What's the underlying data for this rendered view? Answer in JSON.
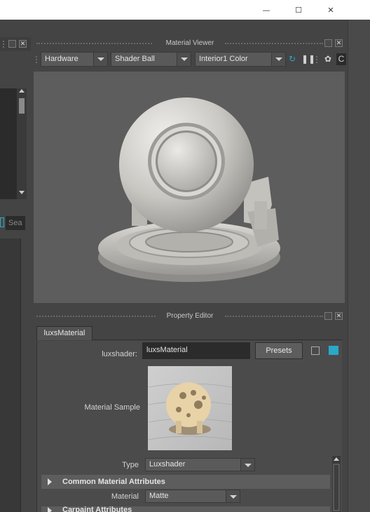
{
  "window": {
    "min_glyph": "—",
    "max_glyph": "☐",
    "close_glyph": "✕"
  },
  "left_panel": {
    "search_placeholder": "Sea"
  },
  "material_viewer": {
    "title": "Material Viewer",
    "renderer": "Hardware",
    "geometry": "Shader Ball",
    "environment": "Interior1 Color"
  },
  "property_editor": {
    "title": "Property Editor",
    "tab_label": "luxsMaterial",
    "shader_label": "luxshader:",
    "shader_value": "luxsMaterial",
    "presets_label": "Presets",
    "sample_label": "Material Sample",
    "type_label": "Type",
    "type_value": "Luxshader",
    "section_common": "Common Material Attributes",
    "material_label": "Material",
    "material_value": "Matte",
    "section_next": "Carpaint Attributes"
  },
  "colors": {
    "accent_teal": "#2aa8c8",
    "panel_bg": "#444444",
    "viewport_bg": "#5d5d5d"
  }
}
